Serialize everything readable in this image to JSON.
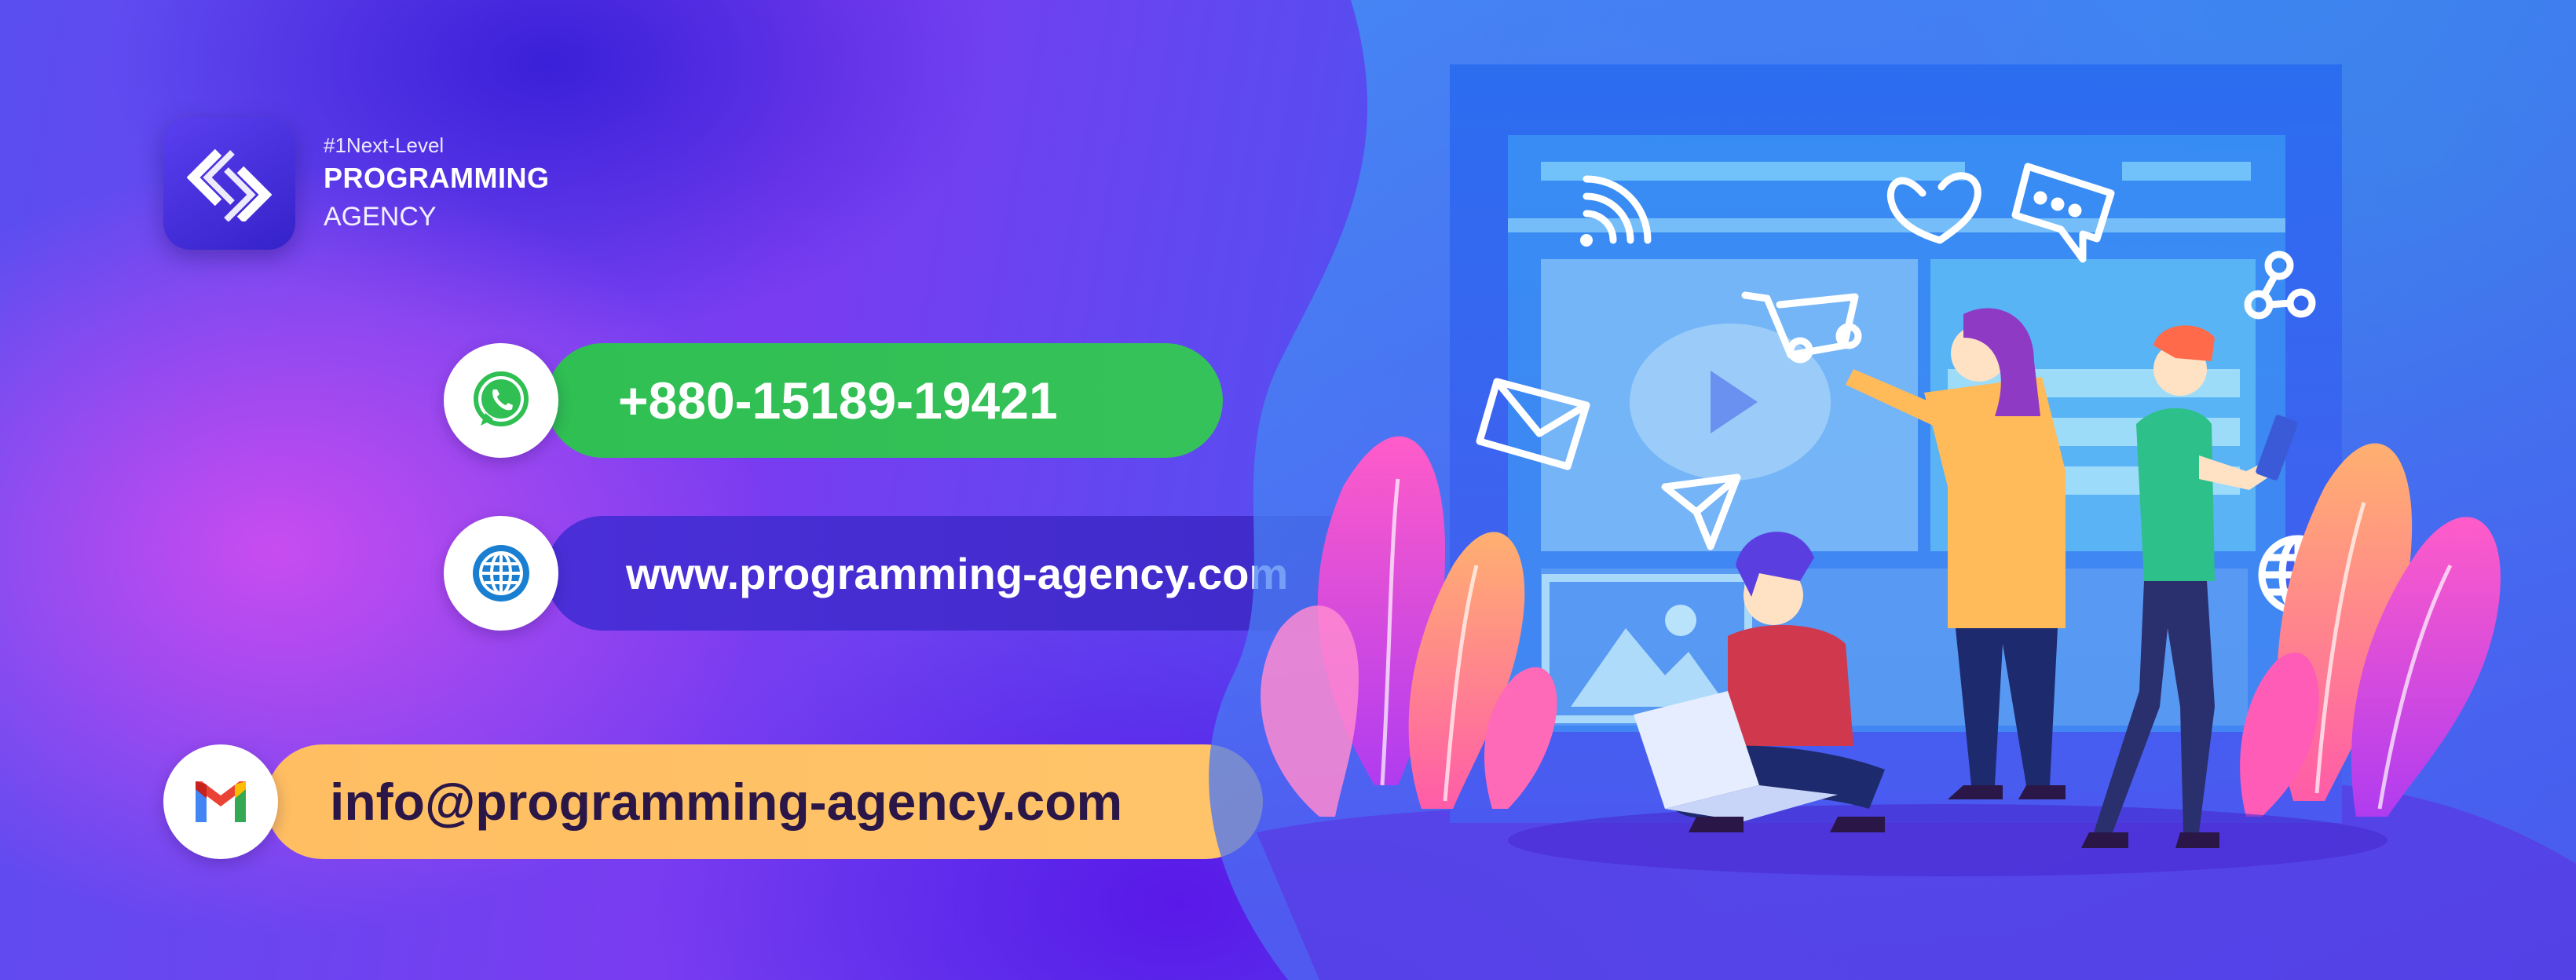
{
  "brand": {
    "tagline": "#1Next-Level",
    "name": "PROGRAMMING",
    "sub": "AGENCY"
  },
  "contacts": {
    "phone": {
      "icon": "whatsapp-icon",
      "value": "+880-15189-19421",
      "color": "#36c25a"
    },
    "website": {
      "icon": "globe-icon",
      "value": "www.programming-agency.com",
      "color": "#4330d0"
    },
    "email": {
      "icon": "gmail-icon",
      "value": "info@programming-agency.com",
      "color": "#ffc46a"
    }
  },
  "illustration": {
    "icons": [
      "wifi-icon",
      "heart-icon",
      "chat-bubble-icon",
      "share-icon",
      "shopping-cart-icon",
      "envelope-icon",
      "paper-plane-icon",
      "play-icon",
      "image-icon",
      "globe-icon"
    ]
  }
}
